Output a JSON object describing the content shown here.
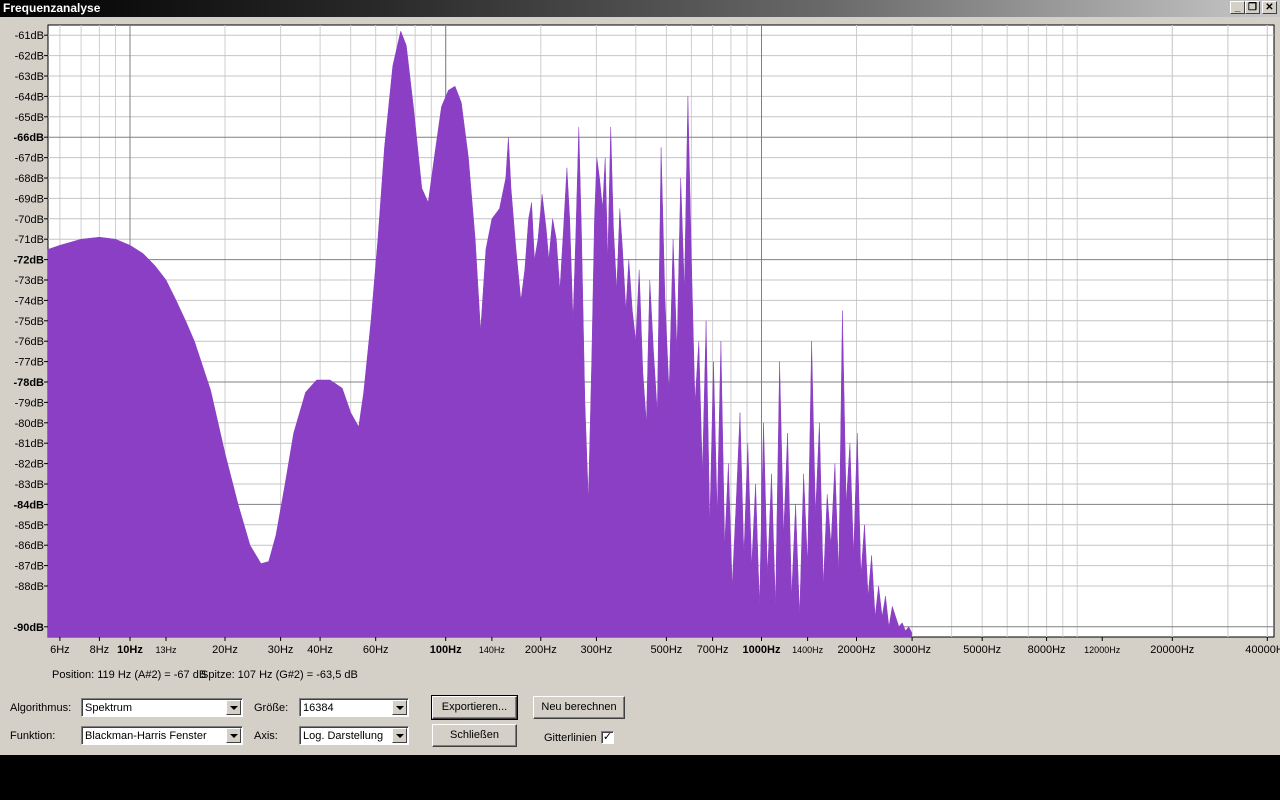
{
  "window": {
    "title": "Frequenzanalyse",
    "controls": {
      "minimize": "_",
      "restore": "❐",
      "close": "✕"
    }
  },
  "chart_data": {
    "type": "area",
    "x_scale": "log",
    "xlim": [
      5.5,
      42000
    ],
    "ylim": [
      -90.5,
      -60.5
    ],
    "grid": true,
    "fill_color": "#8a3fc4",
    "y_ticks": [
      {
        "v": -61,
        "label": "-61dB",
        "bold": false
      },
      {
        "v": -62,
        "label": "-62dB",
        "bold": false
      },
      {
        "v": -63,
        "label": "-63dB",
        "bold": false
      },
      {
        "v": -64,
        "label": "-64dB",
        "bold": false
      },
      {
        "v": -65,
        "label": "-65dB",
        "bold": false
      },
      {
        "v": -66,
        "label": "-66dB",
        "bold": true
      },
      {
        "v": -67,
        "label": "-67dB",
        "bold": false
      },
      {
        "v": -68,
        "label": "-68dB",
        "bold": false
      },
      {
        "v": -69,
        "label": "-69dB",
        "bold": false
      },
      {
        "v": -70,
        "label": "-70dB",
        "bold": false
      },
      {
        "v": -71,
        "label": "-71dB",
        "bold": false
      },
      {
        "v": -72,
        "label": "-72dB",
        "bold": true
      },
      {
        "v": -73,
        "label": "-73dB",
        "bold": false
      },
      {
        "v": -74,
        "label": "-74dB",
        "bold": false
      },
      {
        "v": -75,
        "label": "-75dB",
        "bold": false
      },
      {
        "v": -76,
        "label": "-76dB",
        "bold": false
      },
      {
        "v": -77,
        "label": "-77dB",
        "bold": false
      },
      {
        "v": -78,
        "label": "-78dB",
        "bold": true
      },
      {
        "v": -79,
        "label": "-79dB",
        "bold": false
      },
      {
        "v": -80,
        "label": "-80dB",
        "bold": false
      },
      {
        "v": -81,
        "label": "-81dB",
        "bold": false
      },
      {
        "v": -82,
        "label": "-82dB",
        "bold": false
      },
      {
        "v": -83,
        "label": "-83dB",
        "bold": false
      },
      {
        "v": -84,
        "label": "-84dB",
        "bold": true
      },
      {
        "v": -85,
        "label": "-85dB",
        "bold": false
      },
      {
        "v": -86,
        "label": "-86dB",
        "bold": false
      },
      {
        "v": -87,
        "label": "-87dB",
        "bold": false
      },
      {
        "v": -88,
        "label": "-88dB",
        "bold": false
      },
      {
        "v": -90,
        "label": "-90dB",
        "bold": true
      }
    ],
    "x_ticks": [
      {
        "v": 6,
        "label": "6Hz",
        "bold": false,
        "small": false
      },
      {
        "v": 8,
        "label": "8Hz",
        "bold": false,
        "small": false
      },
      {
        "v": 10,
        "label": "10Hz",
        "bold": true,
        "small": false
      },
      {
        "v": 13,
        "label": "13Hz",
        "bold": false,
        "small": true
      },
      {
        "v": 20,
        "label": "20Hz",
        "bold": false,
        "small": false
      },
      {
        "v": 30,
        "label": "30Hz",
        "bold": false,
        "small": false
      },
      {
        "v": 40,
        "label": "40Hz",
        "bold": false,
        "small": false
      },
      {
        "v": 60,
        "label": "60Hz",
        "bold": false,
        "small": false
      },
      {
        "v": 100,
        "label": "100Hz",
        "bold": true,
        "small": false
      },
      {
        "v": 140,
        "label": "140Hz",
        "bold": false,
        "small": true
      },
      {
        "v": 200,
        "label": "200Hz",
        "bold": false,
        "small": false
      },
      {
        "v": 300,
        "label": "300Hz",
        "bold": false,
        "small": false
      },
      {
        "v": 500,
        "label": "500Hz",
        "bold": false,
        "small": false
      },
      {
        "v": 700,
        "label": "700Hz",
        "bold": false,
        "small": false
      },
      {
        "v": 1000,
        "label": "1000Hz",
        "bold": true,
        "small": false
      },
      {
        "v": 1400,
        "label": "1400Hz",
        "bold": false,
        "small": true
      },
      {
        "v": 2000,
        "label": "2000Hz",
        "bold": false,
        "small": false
      },
      {
        "v": 3000,
        "label": "3000Hz",
        "bold": false,
        "small": false
      },
      {
        "v": 5000,
        "label": "5000Hz",
        "bold": false,
        "small": false
      },
      {
        "v": 8000,
        "label": "8000Hz",
        "bold": false,
        "small": false
      },
      {
        "v": 12000,
        "label": "12000Hz",
        "bold": false,
        "small": true
      },
      {
        "v": 20000,
        "label": "20000Hz",
        "bold": false,
        "small": false
      },
      {
        "v": 40000,
        "label": "40000Hz",
        "bold": false,
        "small": false
      }
    ],
    "series": [
      {
        "points": [
          [
            5.5,
            -71.5
          ],
          [
            6,
            -71.3
          ],
          [
            7,
            -71.0
          ],
          [
            8,
            -70.9
          ],
          [
            9,
            -71.0
          ],
          [
            10,
            -71.3
          ],
          [
            11,
            -71.7
          ],
          [
            12,
            -72.3
          ],
          [
            13,
            -73.0
          ],
          [
            14,
            -74.0
          ],
          [
            15,
            -75.0
          ],
          [
            16,
            -76.0
          ],
          [
            18,
            -78.4
          ],
          [
            20,
            -81.5
          ],
          [
            22,
            -84.0
          ],
          [
            24,
            -86.0
          ],
          [
            26,
            -86.9
          ],
          [
            27.5,
            -86.8
          ],
          [
            29,
            -85.5
          ],
          [
            31,
            -83.0
          ],
          [
            33,
            -80.5
          ],
          [
            36,
            -78.5
          ],
          [
            39,
            -77.9
          ],
          [
            43,
            -77.9
          ],
          [
            47,
            -78.3
          ],
          [
            50,
            -79.5
          ],
          [
            53,
            -80.2
          ],
          [
            55,
            -78.5
          ],
          [
            58,
            -75.0
          ],
          [
            61,
            -71.0
          ],
          [
            64,
            -66.5
          ],
          [
            68,
            -62.5
          ],
          [
            72,
            -60.8
          ],
          [
            75,
            -61.5
          ],
          [
            79,
            -64.5
          ],
          [
            84,
            -68.5
          ],
          [
            88,
            -69.2
          ],
          [
            92,
            -67.0
          ],
          [
            97,
            -64.5
          ],
          [
            102,
            -63.7
          ],
          [
            107,
            -63.5
          ],
          [
            112,
            -64.3
          ],
          [
            118,
            -67.0
          ],
          [
            124,
            -71.0
          ],
          [
            129,
            -75.5
          ],
          [
            134,
            -71.5
          ],
          [
            140,
            -70.0
          ],
          [
            148,
            -69.5
          ],
          [
            155,
            -68.0
          ],
          [
            158,
            -66.0
          ],
          [
            161,
            -68.5
          ],
          [
            167,
            -71.5
          ],
          [
            173,
            -74.0
          ],
          [
            178,
            -72.5
          ],
          [
            183,
            -70.0
          ],
          [
            187,
            -69.2
          ],
          [
            191,
            -72.0
          ],
          [
            196,
            -71.0
          ],
          [
            202,
            -68.8
          ],
          [
            208,
            -70.5
          ],
          [
            212,
            -72.0
          ],
          [
            218,
            -70.0
          ],
          [
            224,
            -71.0
          ],
          [
            230,
            -73.5
          ],
          [
            236,
            -70.5
          ],
          [
            242,
            -67.5
          ],
          [
            247,
            -70.0
          ],
          [
            253,
            -75.0
          ],
          [
            258,
            -71.0
          ],
          [
            264,
            -65.5
          ],
          [
            269,
            -70.5
          ],
          [
            276,
            -79.0
          ],
          [
            283,
            -83.8
          ],
          [
            290,
            -77.0
          ],
          [
            296,
            -70.0
          ],
          [
            301,
            -67.0
          ],
          [
            307,
            -68.0
          ],
          [
            314,
            -69.5
          ],
          [
            320,
            -67.0
          ],
          [
            326,
            -72.0
          ],
          [
            333,
            -65.5
          ],
          [
            340,
            -70.5
          ],
          [
            348,
            -73.5
          ],
          [
            356,
            -69.5
          ],
          [
            363,
            -71.5
          ],
          [
            372,
            -74.5
          ],
          [
            380,
            -72.0
          ],
          [
            390,
            -74.5
          ],
          [
            400,
            -76.0
          ],
          [
            410,
            -72.5
          ],
          [
            421,
            -77.5
          ],
          [
            432,
            -80.0
          ],
          [
            443,
            -73.0
          ],
          [
            455,
            -76.5
          ],
          [
            468,
            -79.5
          ],
          [
            481,
            -66.5
          ],
          [
            495,
            -74.0
          ],
          [
            510,
            -78.5
          ],
          [
            525,
            -71.0
          ],
          [
            540,
            -76.5
          ],
          [
            555,
            -68.0
          ],
          [
            570,
            -73.5
          ],
          [
            585,
            -64.0
          ],
          [
            600,
            -72.0
          ],
          [
            616,
            -79.0
          ],
          [
            633,
            -76.0
          ],
          [
            650,
            -82.5
          ],
          [
            668,
            -75.0
          ],
          [
            686,
            -85.0
          ],
          [
            705,
            -77.0
          ],
          [
            724,
            -84.5
          ],
          [
            744,
            -76.0
          ],
          [
            765,
            -86.0
          ],
          [
            786,
            -82.0
          ],
          [
            808,
            -88.0
          ],
          [
            831,
            -84.0
          ],
          [
            855,
            -79.5
          ],
          [
            880,
            -86.5
          ],
          [
            905,
            -81.0
          ],
          [
            931,
            -87.0
          ],
          [
            958,
            -83.0
          ],
          [
            986,
            -89.0
          ],
          [
            1015,
            -80.0
          ],
          [
            1045,
            -87.5
          ],
          [
            1076,
            -82.5
          ],
          [
            1108,
            -89.0
          ],
          [
            1141,
            -77.0
          ],
          [
            1175,
            -85.5
          ],
          [
            1210,
            -80.5
          ],
          [
            1246,
            -88.5
          ],
          [
            1283,
            -84.0
          ],
          [
            1321,
            -89.5
          ],
          [
            1360,
            -82.5
          ],
          [
            1400,
            -87.0
          ],
          [
            1441,
            -76.0
          ],
          [
            1483,
            -84.5
          ],
          [
            1526,
            -80.0
          ],
          [
            1570,
            -88.0
          ],
          [
            1615,
            -83.5
          ],
          [
            1661,
            -86.0
          ],
          [
            1708,
            -82.0
          ],
          [
            1756,
            -87.5
          ],
          [
            1805,
            -74.5
          ],
          [
            1855,
            -84.0
          ],
          [
            1906,
            -81.0
          ],
          [
            1958,
            -86.5
          ],
          [
            2011,
            -80.5
          ],
          [
            2065,
            -87.5
          ],
          [
            2120,
            -85.0
          ],
          [
            2176,
            -88.5
          ],
          [
            2233,
            -86.5
          ],
          [
            2291,
            -89.5
          ],
          [
            2350,
            -88.0
          ],
          [
            2410,
            -89.5
          ],
          [
            2471,
            -88.5
          ],
          [
            2533,
            -90.0
          ],
          [
            2596,
            -89.0
          ],
          [
            2660,
            -89.5
          ],
          [
            2725,
            -90.0
          ],
          [
            2791,
            -89.8
          ],
          [
            2858,
            -90.2
          ],
          [
            2926,
            -90.0
          ],
          [
            2995,
            -90.3
          ]
        ]
      }
    ]
  },
  "status": {
    "position": "Position: 119 Hz (A#2) = -67 dB",
    "peak": "Spitze: 107 Hz (G#2) = -63,5 dB"
  },
  "controls": {
    "algorithm_label": "Algorithmus:",
    "algorithm_value": "Spektrum",
    "function_label": "Funktion:",
    "function_value": "Blackman-Harris Fenster",
    "size_label": "Größe:",
    "size_value": "16384",
    "axis_label": "Axis:",
    "axis_value": "Log. Darstellung",
    "export_label": "Exportieren...",
    "recalc_label": "Neu berechnen",
    "close_label": "Schließen",
    "gridlines_label": "Gitterlinien",
    "gridlines_checked": "✓"
  }
}
